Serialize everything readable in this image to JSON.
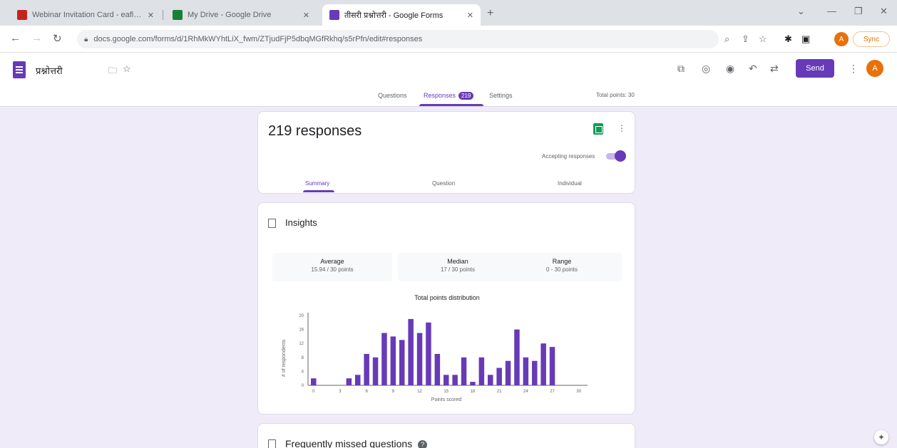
{
  "browser": {
    "tabs": [
      {
        "title": "Webinar Invitation Card - eaflyn",
        "favicon_color": "#c5221f"
      },
      {
        "title": "My Drive - Google Drive",
        "favicon_color": "#188038"
      },
      {
        "title": "तीसरी प्रश्नोत्तरी - Google Forms",
        "favicon_color": "#673ab7"
      }
    ],
    "url": "docs.google.com/forms/d/1RhMkWYhtLiX_fwm/ZTjudFjP5dbqMGfRkhq/s5rPfn/edit#responses",
    "sync_label": "Sync"
  },
  "form_header": {
    "title": "प्रश्नोत्तरी",
    "send_label": "Send",
    "account_initial": "A",
    "tabs": [
      {
        "label": "Questions"
      },
      {
        "label": "Responses",
        "count": "219"
      },
      {
        "label": "Settings"
      }
    ],
    "total_points": "Total points: 30"
  },
  "responses_card": {
    "title": "219 responses",
    "accepting_label": "Accepting responses",
    "accepting": true,
    "subtabs": [
      "Summary",
      "Question",
      "Individual"
    ]
  },
  "insights_card": {
    "title": "Insights",
    "stats": [
      {
        "label": "Average",
        "value": "15.94 / 30 points"
      },
      {
        "label": "Median",
        "value": "17 / 30 points"
      },
      {
        "label": "Range",
        "value": "0 - 30 points"
      }
    ]
  },
  "faq_card": {
    "title": "Frequently missed questions"
  },
  "chart_data": {
    "type": "bar",
    "title": "Total points distribution",
    "xlabel": "Points scored",
    "ylabel": "# of respondents",
    "x": [
      0,
      1,
      2,
      3,
      4,
      5,
      6,
      7,
      8,
      9,
      10,
      11,
      12,
      13,
      14,
      15,
      16,
      17,
      18,
      19,
      20,
      21,
      22,
      23,
      24,
      25,
      26,
      27,
      28,
      29,
      30
    ],
    "values": [
      2,
      0,
      0,
      0,
      2,
      3,
      9,
      8,
      15,
      14,
      13,
      19,
      15,
      18,
      9,
      3,
      3,
      8,
      1,
      8,
      3,
      5,
      7,
      16,
      8,
      7,
      12,
      11
    ],
    "ylim": [
      0,
      20
    ],
    "yticks": [
      0,
      4,
      8,
      12,
      16,
      20
    ],
    "xticks": [
      0,
      3,
      6,
      9,
      12,
      15,
      18,
      21,
      24,
      27,
      30
    ],
    "bar_color": "#673ab7",
    "grid": false
  }
}
